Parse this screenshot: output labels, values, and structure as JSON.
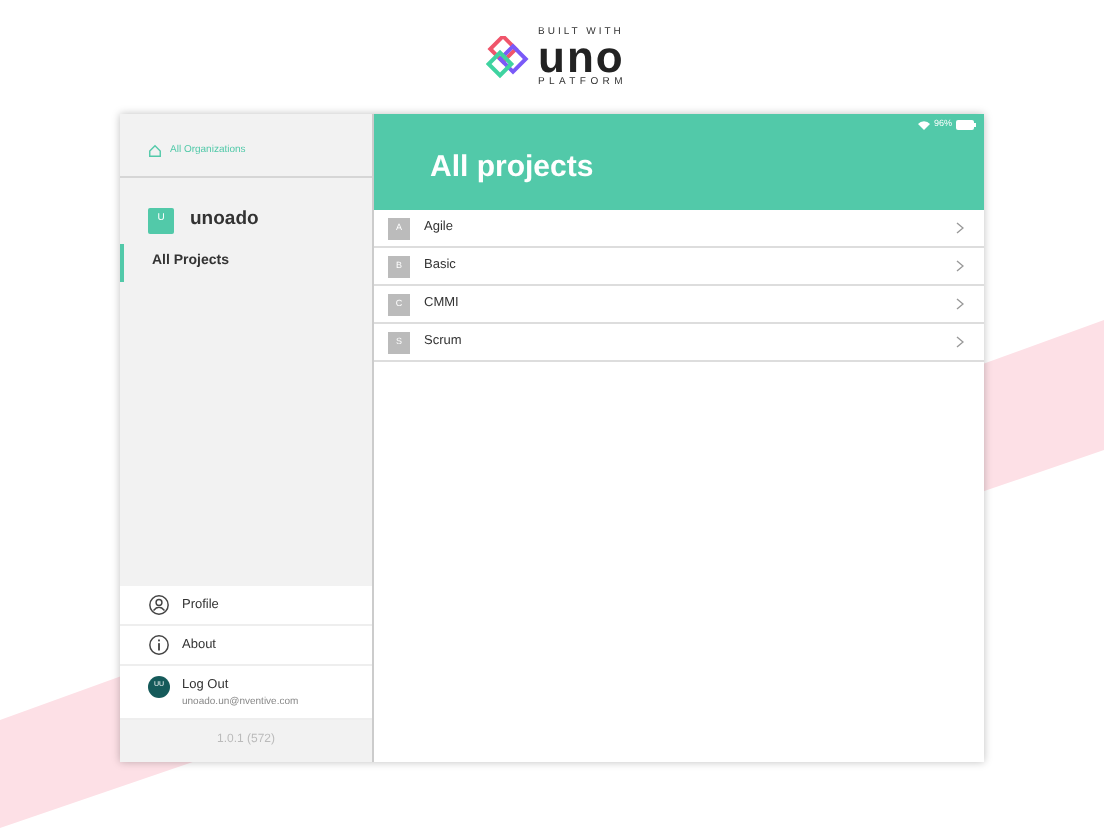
{
  "logo": {
    "tagline": "BUILT WITH",
    "name": "uno",
    "subname": "PLATFORM"
  },
  "status_bar": {
    "battery": "96%"
  },
  "sidebar": {
    "breadcrumb": "All Organizations",
    "organization": {
      "initial": "U",
      "name": "unoado"
    },
    "items": [
      {
        "label": "All Projects",
        "selected": true
      }
    ],
    "menu": [
      {
        "kind": "profile",
        "label": "Profile"
      },
      {
        "kind": "about",
        "label": "About"
      },
      {
        "kind": "logout",
        "label": "Log Out",
        "initials": "UU",
        "detail": "unoado.un@nventive.com"
      }
    ],
    "version": "1.0.1 (572)"
  },
  "header": {
    "title": "All projects"
  },
  "projects": [
    {
      "initial": "A",
      "name": "Agile"
    },
    {
      "initial": "B",
      "name": "Basic"
    },
    {
      "initial": "C",
      "name": "CMMI"
    },
    {
      "initial": "S",
      "name": "Scrum"
    }
  ]
}
